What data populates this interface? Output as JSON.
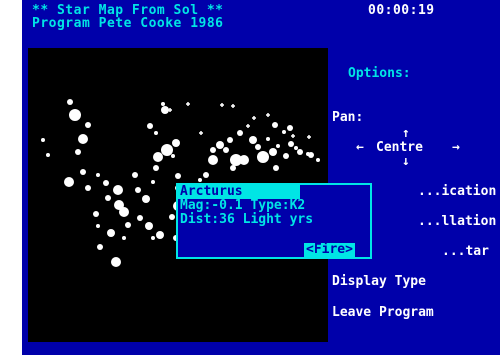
{
  "header": {
    "title": "** Star Map From Sol **",
    "time": "00:00:19",
    "credit": "Program Pete Cooke 1986"
  },
  "options": {
    "heading": "Options:",
    "pan_label": "Pan:",
    "up_arrow": "↑",
    "left_arrow": "←",
    "centre": "Centre",
    "right_arrow": "→",
    "down_arrow": "↓",
    "item_identification": "...ication",
    "item_constellation": "...llation",
    "item_star": "...tar",
    "display_type": "Display Type",
    "leave_program": "Leave Program"
  },
  "star_info": {
    "name": "Arcturus",
    "magnitude_line": "Mag:-0.1 Type:K2",
    "distance_line": "Dist:36 Light yrs",
    "fire_label": "<Fire>"
  },
  "colors": {
    "screen_bg": "#0000aa",
    "accent": "#00e5e5",
    "text": "#ffffff",
    "map_bg": "#000000"
  }
}
